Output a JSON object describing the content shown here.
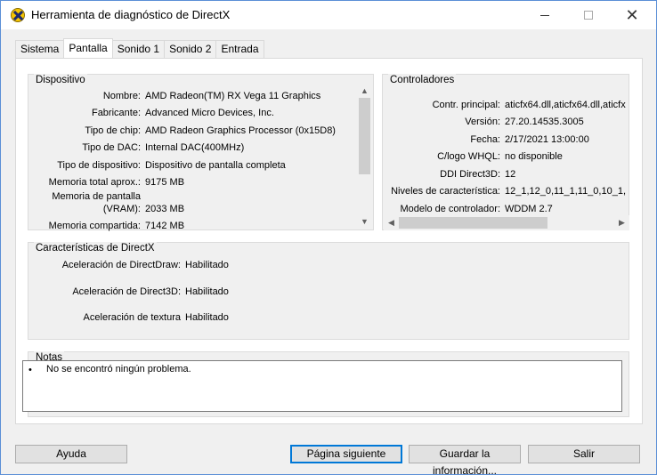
{
  "window": {
    "title": "Herramienta de diagnóstico de DirectX"
  },
  "tabs": [
    {
      "label": "Sistema"
    },
    {
      "label": "Pantalla"
    },
    {
      "label": "Sonido 1"
    },
    {
      "label": "Sonido 2"
    },
    {
      "label": "Entrada"
    }
  ],
  "dispositivo": {
    "legend": "Dispositivo",
    "rows": [
      {
        "label": "Nombre:",
        "value": "AMD Radeon(TM) RX Vega 11 Graphics"
      },
      {
        "label": "Fabricante:",
        "value": "Advanced Micro Devices, Inc."
      },
      {
        "label": "Tipo de chip:",
        "value": "AMD Radeon Graphics Processor (0x15D8)"
      },
      {
        "label": "Tipo de DAC:",
        "value": "Internal DAC(400MHz)"
      },
      {
        "label": "Tipo de dispositivo:",
        "value": "Dispositivo de pantalla completa"
      },
      {
        "label": "Memoria total aprox.:",
        "value": "9175 MB"
      },
      {
        "label": "Memoria de pantalla",
        "value": ""
      },
      {
        "label": "(VRAM):",
        "value": "2033 MB"
      },
      {
        "label": "Memoria compartida:",
        "value": "7142 MB"
      }
    ]
  },
  "controladores": {
    "legend": "Controladores",
    "rows": [
      {
        "label": "Contr. principal:",
        "value": "aticfx64.dll,aticfx64.dll,aticfx"
      },
      {
        "label": "Versión:",
        "value": "27.20.14535.3005"
      },
      {
        "label": "Fecha:",
        "value": "2/17/2021 13:00:00"
      },
      {
        "label": "C/logo WHQL:",
        "value": "no disponible"
      },
      {
        "label": "DDI Direct3D:",
        "value": "12"
      },
      {
        "label": "Niveles de característica:",
        "value": "12_1,12_0,11_1,11_0,10_1,"
      },
      {
        "label": "Modelo de controlador:",
        "value": "WDDM 2.7"
      }
    ]
  },
  "caracteristicas": {
    "legend": "Características de DirectX",
    "rows": [
      {
        "label": "Aceleración de DirectDraw:",
        "value": "Habilitado"
      },
      {
        "label": "Aceleración de Direct3D:",
        "value": "Habilitado"
      },
      {
        "label": "Aceleración de textura",
        "value": "Habilitado"
      }
    ]
  },
  "notas": {
    "legend": "Notas",
    "bullet": "•",
    "items": [
      {
        "text": "No se encontró ningún problema."
      }
    ]
  },
  "buttons": {
    "ayuda": "Ayuda",
    "pagina_siguiente": "Página siguiente",
    "guardar": "Guardar la información...",
    "salir": "Salir"
  },
  "icons": {
    "app": "directx-icon",
    "minimize": "minimize-icon",
    "maximize": "maximize-icon",
    "close": "close-icon"
  },
  "colors": {
    "accent": "#0078d7",
    "panel": "#f0f0f0"
  }
}
